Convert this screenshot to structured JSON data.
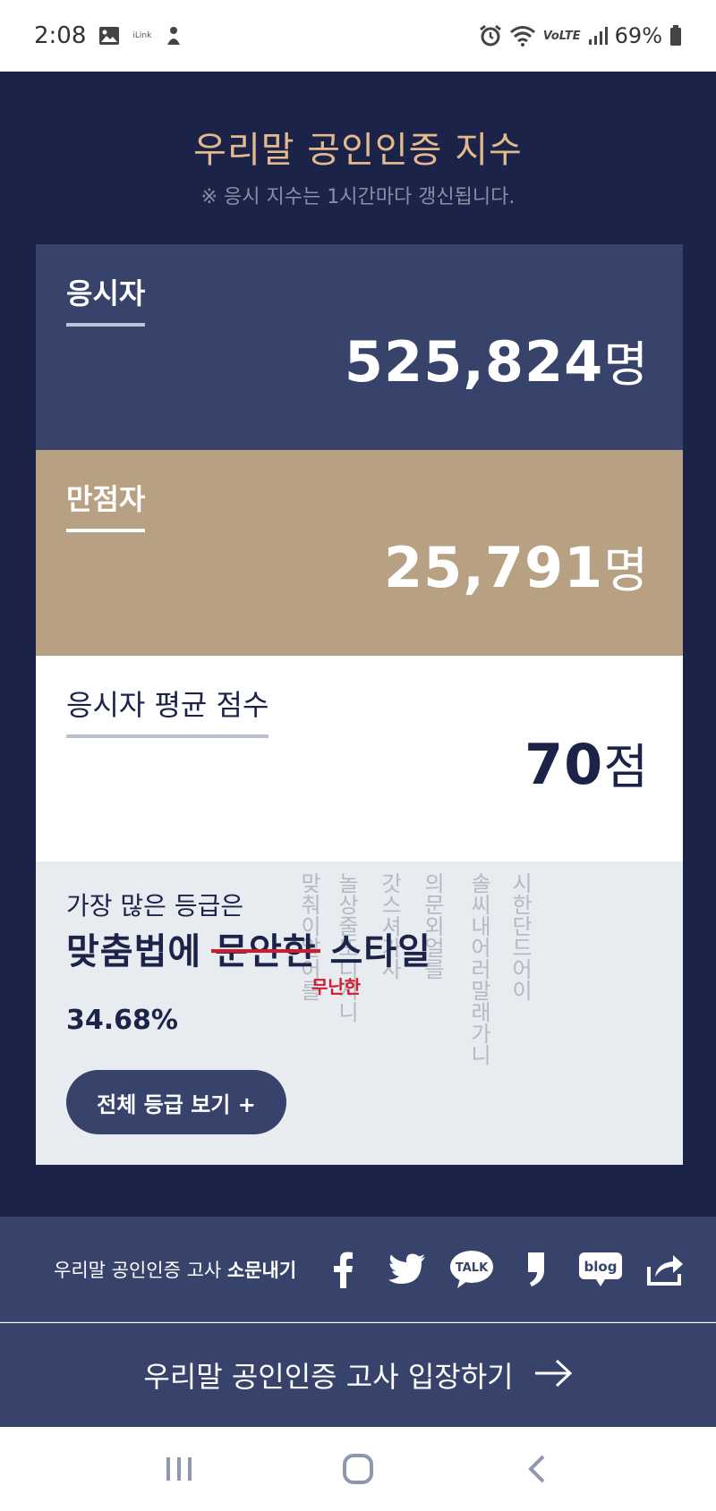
{
  "status_bar": {
    "time": "2:08",
    "ilink": "iLink",
    "network": "VoLTE",
    "battery": "69%"
  },
  "hero": {
    "title": "우리말 공인인증 지수",
    "subtitle": "※ 응시 지수는 1시간마다 갱신됩니다."
  },
  "stats": {
    "takers": {
      "label": "응시자",
      "value": "525,824",
      "unit": "명"
    },
    "perfect": {
      "label": "만점자",
      "value": "25,791",
      "unit": "명"
    },
    "average": {
      "label": "응시자 평균 점수",
      "value": "70",
      "unit": "점"
    }
  },
  "grade": {
    "intro": "가장 많은 등급은",
    "name_prefix": "맞춤법에 ",
    "name_struck": "문안한",
    "name_suffix": " 스타일",
    "correction": "무난한",
    "percent": "34.68%",
    "button_label": "전체 등급 보기 +",
    "bg_columns": [
      "맞춰이알어를",
      "놀상줄또디시니",
      "갓스셔가사",
      "의문외얼를",
      "솔씨내어러말래가니",
      "시한단드어이"
    ]
  },
  "share": {
    "text": "우리말 공인인증 고사 ",
    "strong": "소문내기",
    "icons": [
      "facebook-icon",
      "twitter-icon",
      "kakaotalk-icon",
      "kakaostory-icon",
      "blog-icon",
      "share-icon"
    ],
    "talk_label": "TALK",
    "blog_label": "blog"
  },
  "enter": {
    "label": "우리말 공인인증 고사 입장하기"
  },
  "colors": {
    "navy": "#1b2349",
    "card_blue": "#37436b",
    "card_tan": "#b8a083",
    "title_gold": "#e4b98e",
    "strike_red": "#d01c2e"
  }
}
